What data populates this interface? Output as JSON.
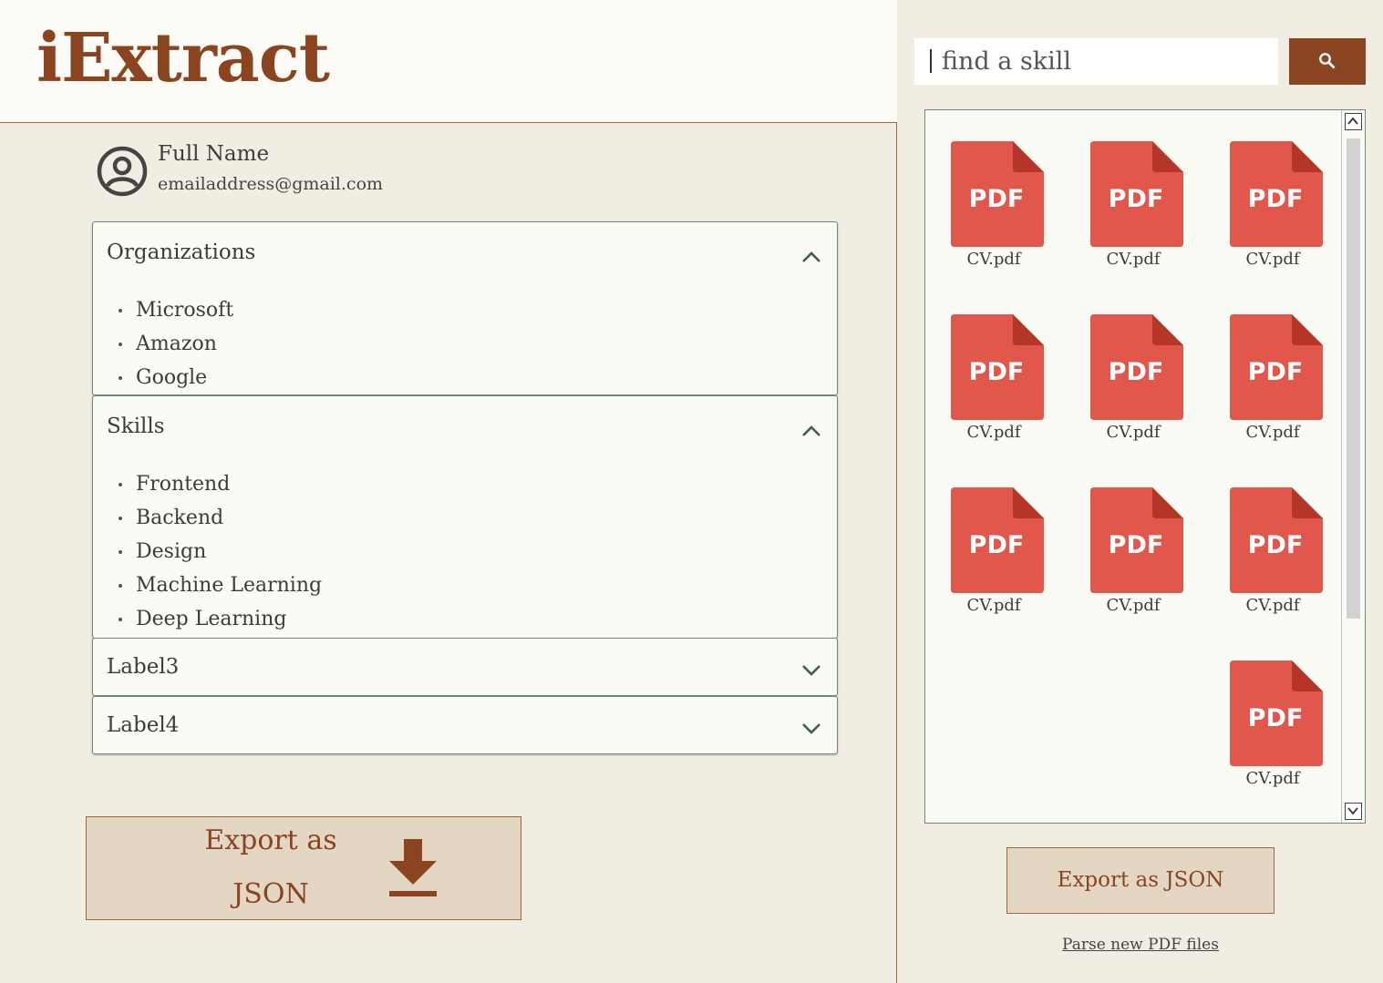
{
  "app": {
    "logo": "iExtract"
  },
  "user": {
    "name": "Full Name",
    "email": "emailaddress@gmail.com",
    "avatar_icon": "user-circle-icon"
  },
  "sections": [
    {
      "label": "Organizations",
      "expanded": true,
      "items": [
        "Microsoft",
        "Amazon",
        "Google"
      ]
    },
    {
      "label": "Skills",
      "expanded": true,
      "items": [
        "Frontend",
        "Backend",
        "Design",
        "Machine Learning",
        "Deep Learning"
      ]
    },
    {
      "label": "Label3",
      "expanded": false,
      "items": []
    },
    {
      "label": "Label4",
      "expanded": false,
      "items": []
    }
  ],
  "export_big": {
    "line1": "Export as",
    "line2": "JSON",
    "icon": "download-icon"
  },
  "search": {
    "placeholder": "find a skill",
    "icon": "search-icon"
  },
  "files": [
    {
      "name": "CV.pdf",
      "badge": "PDF"
    },
    {
      "name": "CV.pdf",
      "badge": "PDF"
    },
    {
      "name": "CV.pdf",
      "badge": "PDF"
    },
    {
      "name": "CV.pdf",
      "badge": "PDF"
    },
    {
      "name": "CV.pdf",
      "badge": "PDF"
    },
    {
      "name": "CV.pdf",
      "badge": "PDF"
    },
    {
      "name": "CV.pdf",
      "badge": "PDF"
    },
    {
      "name": "CV.pdf",
      "badge": "PDF"
    },
    {
      "name": "CV.pdf",
      "badge": "PDF"
    },
    {
      "name": "CV.pdf",
      "badge": "PDF"
    }
  ],
  "right_actions": {
    "export_label": "Export as JSON",
    "parse_label": "Parse new PDF files"
  },
  "colors": {
    "brand": "#8a4520",
    "pdf_red": "#e2574c",
    "pdf_fold": "#b53629",
    "panel_bg": "#fafbf4",
    "page_bg": "#f2ede2"
  }
}
